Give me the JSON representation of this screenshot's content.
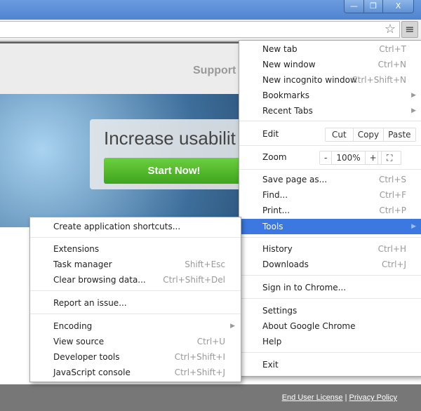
{
  "window": {
    "minimize": "—",
    "restore": "❐",
    "close": "X"
  },
  "toolbar": {
    "star_icon": "☆",
    "menu_icon": "≡"
  },
  "page": {
    "support": "Support",
    "hero_text": "Increase usabilit",
    "start_button": "Start Now!",
    "footer": {
      "eula": "End User License",
      "sep": "|",
      "privacy": "Privacy Policy"
    }
  },
  "menu": {
    "new_tab": {
      "label": "New tab",
      "shortcut": "Ctrl+T"
    },
    "new_window": {
      "label": "New window",
      "shortcut": "Ctrl+N"
    },
    "new_incognito": {
      "label": "New incognito window",
      "shortcut": "Ctrl+Shift+N"
    },
    "bookmarks": {
      "label": "Bookmarks"
    },
    "recent_tabs": {
      "label": "Recent Tabs"
    },
    "edit": {
      "label": "Edit",
      "cut": "Cut",
      "copy": "Copy",
      "paste": "Paste"
    },
    "zoom": {
      "label": "Zoom",
      "minus": "-",
      "value": "100%",
      "plus": "+",
      "fullscreen": "⛶"
    },
    "save_page": {
      "label": "Save page as...",
      "shortcut": "Ctrl+S"
    },
    "find": {
      "label": "Find...",
      "shortcut": "Ctrl+F"
    },
    "print": {
      "label": "Print...",
      "shortcut": "Ctrl+P"
    },
    "tools": {
      "label": "Tools"
    },
    "history": {
      "label": "History",
      "shortcut": "Ctrl+H"
    },
    "downloads": {
      "label": "Downloads",
      "shortcut": "Ctrl+J"
    },
    "sign_in": {
      "label": "Sign in to Chrome..."
    },
    "settings": {
      "label": "Settings"
    },
    "about": {
      "label": "About Google Chrome"
    },
    "help": {
      "label": "Help"
    },
    "exit": {
      "label": "Exit"
    }
  },
  "submenu": {
    "create_shortcuts": {
      "label": "Create application shortcuts..."
    },
    "extensions": {
      "label": "Extensions"
    },
    "task_manager": {
      "label": "Task manager",
      "shortcut": "Shift+Esc"
    },
    "clear_data": {
      "label": "Clear browsing data...",
      "shortcut": "Ctrl+Shift+Del"
    },
    "report": {
      "label": "Report an issue..."
    },
    "encoding": {
      "label": "Encoding"
    },
    "view_source": {
      "label": "View source",
      "shortcut": "Ctrl+U"
    },
    "dev_tools": {
      "label": "Developer tools",
      "shortcut": "Ctrl+Shift+I"
    },
    "js_console": {
      "label": "JavaScript console",
      "shortcut": "Ctrl+Shift+J"
    }
  },
  "colors": {
    "highlight": "#3b78e0",
    "titlebar": "#5a8fd6",
    "start_button": "#4fb82a"
  }
}
